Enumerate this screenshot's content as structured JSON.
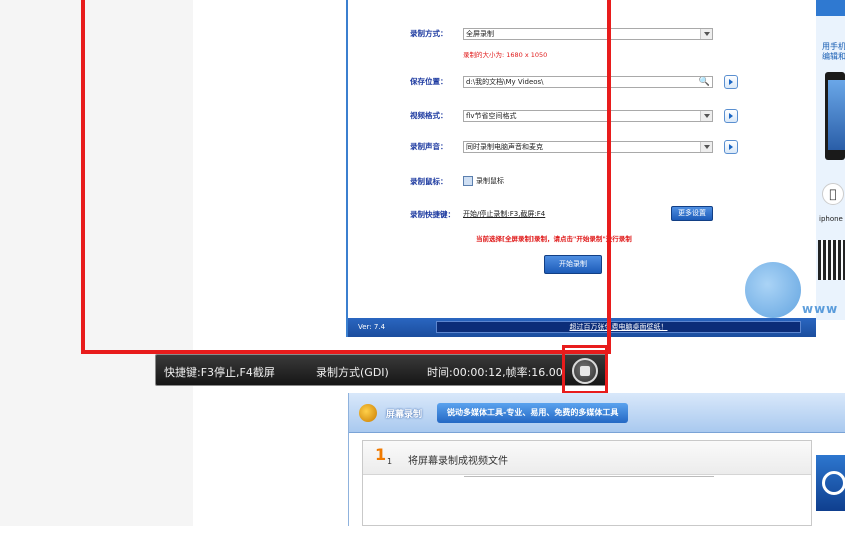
{
  "app_top": {
    "recording_mode": {
      "label": "录制方式：",
      "value": "全屏录制",
      "note": "录制的大小为: 1680 x 1050"
    },
    "save_location": {
      "label": "保存位置：",
      "value": "d:\\我的文档\\My Videos\\"
    },
    "video_format": {
      "label": "视频格式：",
      "value": "flv节省空间格式"
    },
    "recording_audio": {
      "label": "录制声音：",
      "value": "同时录制电脑声音和麦克"
    },
    "recording_mouse": {
      "label": "录制鼠标：",
      "checkbox_label": "录制鼠标"
    },
    "hotkeys": {
      "label": "录制快捷键：",
      "value": "开始/停止录制:F3,截屏:F4",
      "more_settings": "更多设置"
    },
    "hint": "当前选择[全屏录制]录制，请点击\"开始录制\"进行录制",
    "start_button": "开始录制",
    "version": "Ver: 7.4",
    "marquee": "超过百万张免费电脑桌面壁纸！"
  },
  "ad": {
    "text_line1": "用手机",
    "text_line2": "编辑和",
    "iphone_label": "iphone",
    "watermark_url": "www"
  },
  "rec_bar": {
    "hotkeys": "快捷键:F3停止,F4截屏",
    "mode": "录制方式(GDI)",
    "time": "时间:00:00:12,帧率:16.00"
  },
  "app_bot": {
    "title": "屏幕录制",
    "slogan": "锐动多媒体工具-专业、易用、免费的多媒体工具",
    "step_number": "1",
    "step_sub": "1",
    "step_text": "将屏幕录制成视频文件"
  },
  "colors": {
    "highlight_red": "#e81c1c",
    "app_blue": "#1b4d9e",
    "label_blue": "#1d3aa0"
  }
}
